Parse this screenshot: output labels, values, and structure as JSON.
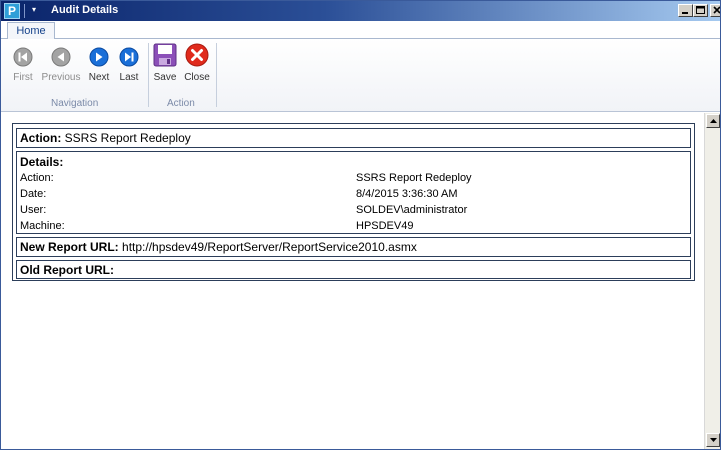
{
  "window": {
    "title": "Audit Details",
    "app_icon_letter": "P",
    "quick_access_glyph": "▾"
  },
  "ribbon": {
    "tabs": [
      {
        "label": "Home",
        "active": true
      }
    ],
    "groups": [
      {
        "label": "Navigation",
        "buttons": [
          {
            "label": "First",
            "icon": "first-record-icon",
            "enabled": false
          },
          {
            "label": "Previous",
            "icon": "previous-record-icon",
            "enabled": false
          },
          {
            "label": "Next",
            "icon": "next-record-icon",
            "enabled": true
          },
          {
            "label": "Last",
            "icon": "last-record-icon",
            "enabled": true
          }
        ]
      },
      {
        "label": "Action",
        "buttons": [
          {
            "label": "Save",
            "icon": "floppy-disk-icon",
            "enabled": true
          },
          {
            "label": "Close",
            "icon": "close-x-icon",
            "enabled": true
          }
        ]
      }
    ]
  },
  "audit": {
    "action_label": "Action:",
    "action_value": "SSRS Report Redeploy",
    "details_label": "Details:",
    "details": [
      {
        "key": "Action:",
        "value": "SSRS Report Redeploy"
      },
      {
        "key": "Date:",
        "value": "8/4/2015 3:36:30 AM"
      },
      {
        "key": "User:",
        "value": "SOLDEV\\administrator"
      },
      {
        "key": "Machine:",
        "value": "HPSDEV49"
      }
    ],
    "new_url_label": "New Report URL:",
    "new_url_value": "http://hpsdev49/ReportServer/ReportService2010.asmx",
    "old_url_label": "Old Report URL:",
    "old_url_value": ""
  },
  "colors": {
    "title_bar_start": "#0a246a",
    "nav_button_blue": "#1a6fd8",
    "nav_button_disabled": "#9a9a9a",
    "close_red": "#e02a1c",
    "save_purple": "#8b4fb8"
  }
}
